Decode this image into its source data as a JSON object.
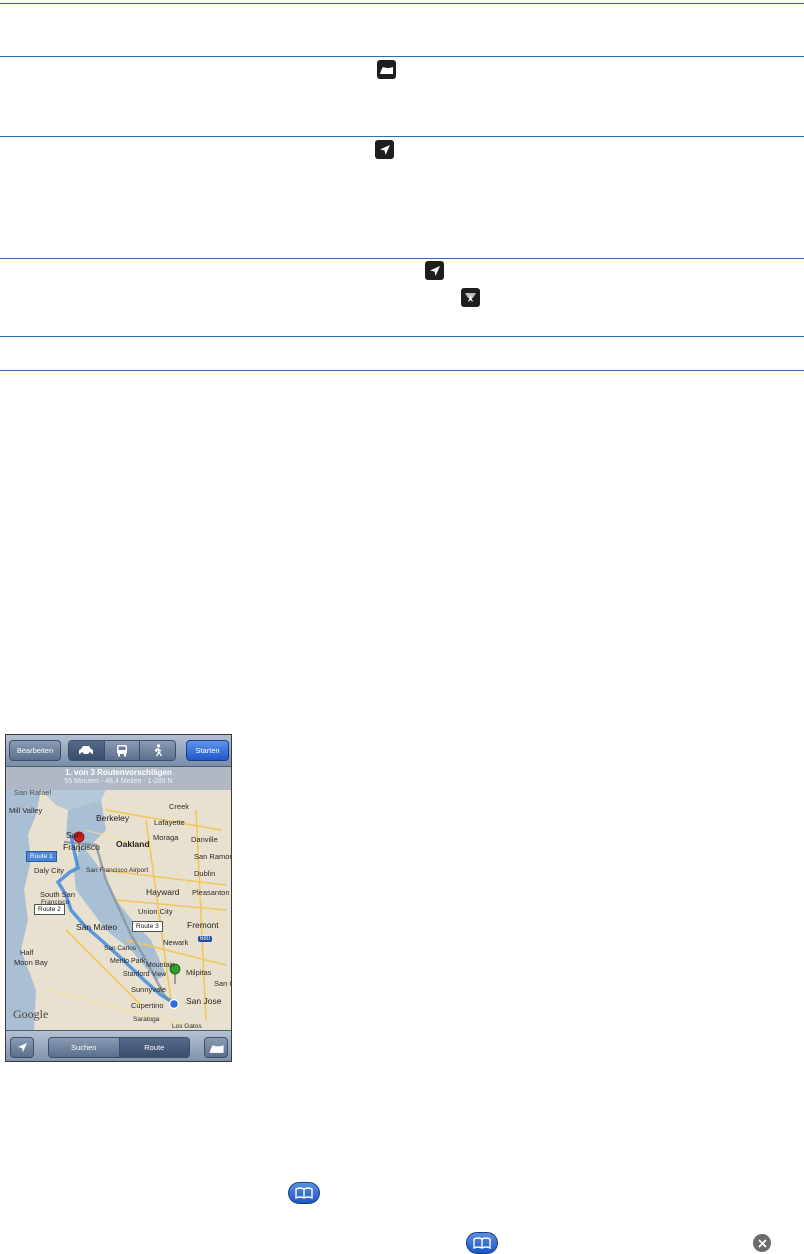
{
  "phone": {
    "nav": {
      "edit_label": "Bearbeiten",
      "start_label": "Starten"
    },
    "banner": {
      "title": "1. von 3 Routenvorschlägen",
      "subtitle": "55 Minuten - 48,4 Meilen - 1-280 N"
    },
    "map_labels": {
      "san_rafael": "San Rafael",
      "mill_valley": "Mill Valley",
      "berkeley": "Berkeley",
      "creek": "Creek",
      "lafayette": "Lafayette",
      "moraga": "Moraga",
      "danville": "Danville",
      "san": "San",
      "francisco": "Francisco",
      "oakland": "Oakland",
      "san_ramon": "San Ramon",
      "daly_city": "Daly City",
      "south_sf_airport": "San Francisco Airport",
      "dublin": "Dublin",
      "south_sa": "South San",
      "francisco2": "Francisco",
      "hayward": "Hayward",
      "pleasanton": "Pleasanton",
      "union_city": "Union City",
      "fremont": "Fremont",
      "san_mateo": "San Mateo",
      "newark": "Newark",
      "half": "Half",
      "moon_bay": "Moon Bay",
      "san_carlos": "San Carlos",
      "menlo_park": "Menlo Park",
      "stanford": "Stanford",
      "mountain_view": "Mountain",
      "view": "View",
      "milpitas": "Milpitas",
      "sunnyvale": "Sunnyvale",
      "san_jose": "San Jose",
      "cupertino": "Cupertino",
      "saratoga": "Saratoga",
      "los_gatos": "Los Gatos",
      "san_cl": "San Cl",
      "hwy": "680"
    },
    "routes": {
      "r1": "Route 1",
      "r2": "Route 2",
      "r3": "Route 3"
    },
    "logo": "Google",
    "toolbar": {
      "search_label": "Suchen",
      "route_label": "Route"
    }
  },
  "colors": {
    "rule": "#2f6fb6",
    "route_main": "#4a8fe0",
    "route_alt": "#8a96a6",
    "water": "#a9bfd3",
    "land": "#e8e1cf"
  }
}
